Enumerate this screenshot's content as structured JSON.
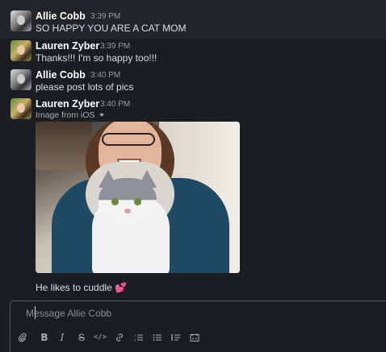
{
  "messages": [
    {
      "author": "Allie Cobb",
      "time": "3:39 PM",
      "text": "SO HAPPY YOU ARE A CAT MOM"
    },
    {
      "author": "Lauren Zyber",
      "time": "3:39 PM",
      "text": "Thanks!!! I'm so happy too!!!"
    },
    {
      "author": "Allie Cobb",
      "time": "3:40 PM",
      "text": "please post lots of pics"
    },
    {
      "author": "Lauren Zyber",
      "time": "3:40 PM",
      "attachment_label": "Image from iOS",
      "caption": "He likes to cuddle",
      "caption_emoji": "💕"
    }
  ],
  "composer": {
    "placeholder": "Message Allie Cobb"
  },
  "toolbar": {
    "attach_icon": "paperclip-icon",
    "bold_label": "B",
    "italic_label": "I",
    "strike_label": "S",
    "code_label": "</>",
    "link_icon": "link-icon",
    "ordered_list_icon": "ordered-list-icon",
    "bulleted_list_icon": "bulleted-list-icon",
    "blockquote_icon": "blockquote-icon",
    "code_block_icon": "code-block-icon"
  },
  "colors": {
    "background": "#1a1d21",
    "highlight": "#222529",
    "name": "#ffffff",
    "timestamp": "#9a9b9d",
    "emoji_heart": "#ff4fa0"
  }
}
